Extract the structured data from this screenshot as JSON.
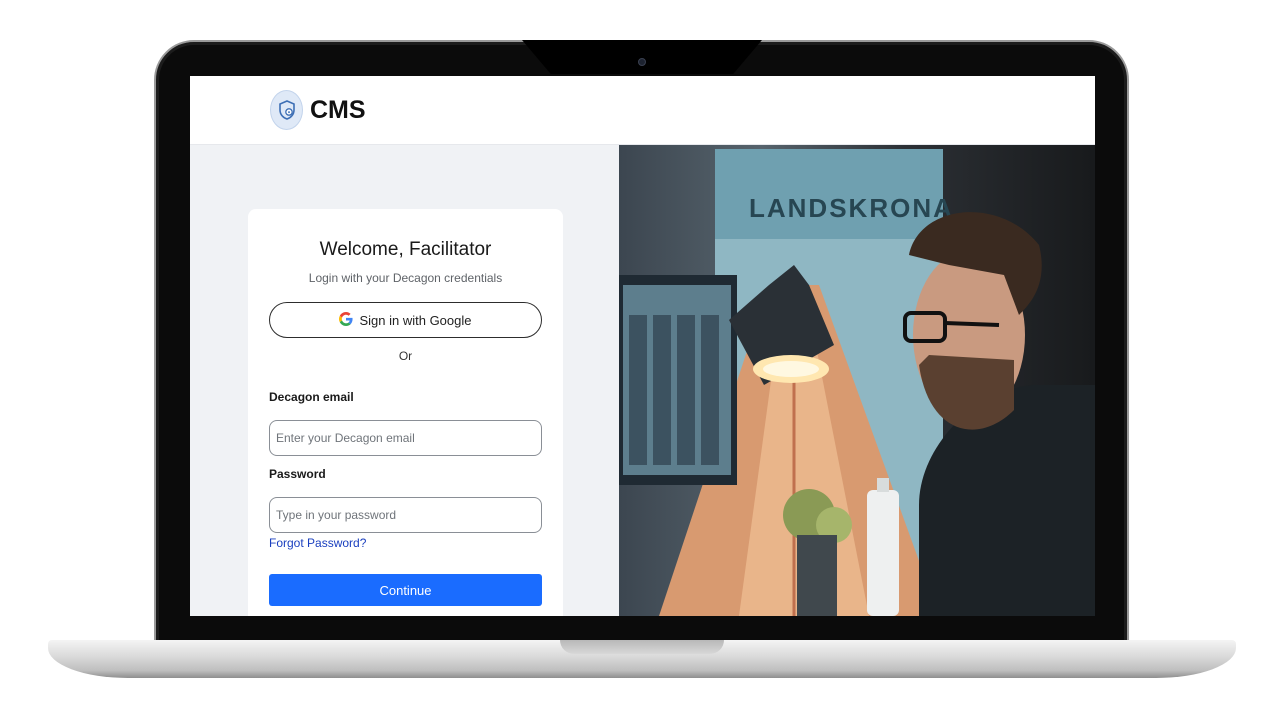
{
  "app": {
    "logo_icon": "shield-lock-icon",
    "brand": "CMS"
  },
  "login": {
    "title": "Welcome, Facilitator",
    "subtitle": "Login with your Decagon credentials",
    "google_icon": "google-icon",
    "google_button": "Sign in with Google",
    "divider": "Or",
    "email_label": "Decagon email",
    "email_placeholder": "Enter your Decagon email",
    "email_value": "",
    "password_label": "Password",
    "password_placeholder": "Type in your password",
    "password_value": "",
    "forgot_link": "Forgot Password?",
    "continue_button": "Continue"
  },
  "hero_image": {
    "poster_text": "LANDSKRONA"
  },
  "colors": {
    "primary": "#1a6cff",
    "link": "#1a3fbf",
    "page_bg": "#f0f2f5"
  }
}
